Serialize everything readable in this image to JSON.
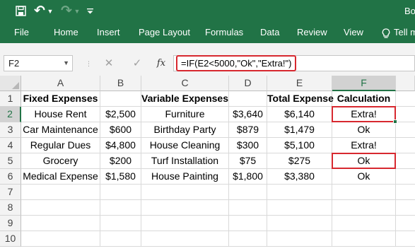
{
  "titlebar": {
    "title": "Bo",
    "icons": {
      "save": "save-icon",
      "undo": "undo-icon",
      "redo": "redo-icon",
      "customize": "customize-quick-access-icon"
    },
    "colors": {
      "accent": "#217346",
      "highlight": "#d7282f"
    }
  },
  "ribbon": {
    "tabs": [
      "File",
      "Home",
      "Insert",
      "Page Layout",
      "Formulas",
      "Data",
      "Review",
      "View"
    ],
    "tell_me": "Tell m",
    "tell_me_icon": "lightbulb-icon"
  },
  "formula_bar": {
    "name_box": "F2",
    "cancel_icon": "✕",
    "enter_icon": "✓",
    "fx_label": "fx",
    "formula": "=IF(E2<5000,\"Ok\",\"Extra!\")"
  },
  "sheet": {
    "columns": [
      "A",
      "B",
      "C",
      "D",
      "E",
      "F"
    ],
    "rows": [
      "1",
      "2",
      "3",
      "4",
      "5",
      "6",
      "7",
      "8",
      "9",
      "10"
    ],
    "headers": [
      "Fixed Expenses",
      "",
      "Variable Expenses",
      "",
      "Total Expense",
      "Calculation"
    ],
    "data": [
      [
        "House Rent",
        "$2,500",
        "Furniture",
        "$3,640",
        "$6,140",
        "Extra!"
      ],
      [
        "Car Maintenance",
        "$600",
        "Birthday Party",
        "$879",
        "$1,479",
        "Ok"
      ],
      [
        "Regular Dues",
        "$4,800",
        "House Cleaning",
        "$300",
        "$5,100",
        "Extra!"
      ],
      [
        "Grocery",
        "$200",
        "Turf Installation",
        "$75",
        "$275",
        "Ok"
      ],
      [
        "Medical Expense",
        "$1,580",
        "House Painting",
        "$1,800",
        "$3,380",
        "Ok"
      ]
    ],
    "selected_cell": "F2"
  }
}
